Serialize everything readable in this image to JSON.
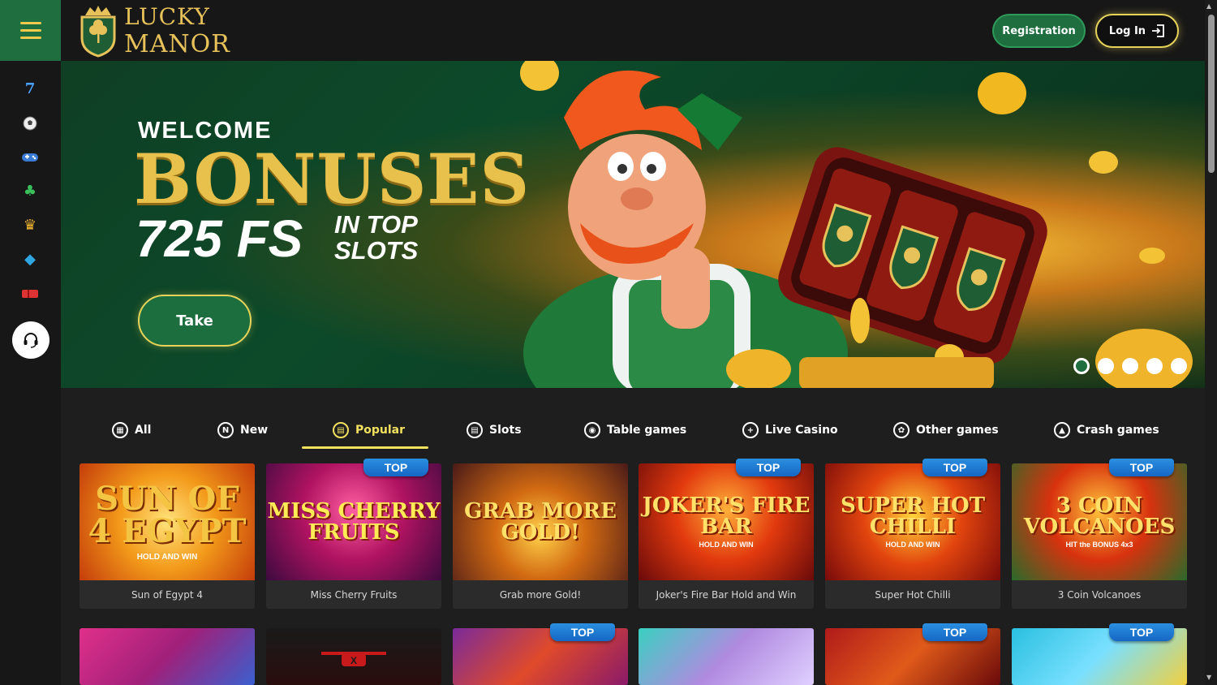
{
  "brand": {
    "logo_line1": "LUCKY",
    "logo_line2": "MANOR",
    "accent": "#1f6e3f",
    "gold": "#e6d35a"
  },
  "header": {
    "registration_label": "Registration",
    "login_label": "Log In"
  },
  "sidebar": {
    "items": [
      {
        "icon": "slot-seven-icon",
        "glyph": "7"
      },
      {
        "icon": "soccer-ball-icon",
        "glyph": "⚽"
      },
      {
        "icon": "gamepad-icon",
        "glyph": "🎮"
      },
      {
        "icon": "clover-icon",
        "glyph": "♣"
      },
      {
        "icon": "crown-icon",
        "glyph": "♛"
      },
      {
        "icon": "gem-icon",
        "glyph": "◆"
      },
      {
        "icon": "ticket-icon",
        "glyph": "▬"
      }
    ],
    "support_icon": "headset-icon"
  },
  "banner": {
    "welcome": "WELCOME",
    "bonuses": "BONUSES",
    "fs": "725 FS",
    "in_top_line1": "IN TOP",
    "in_top_line2": "SLOTS",
    "take_label": "Take",
    "slides": 5,
    "active_slide": 1
  },
  "tabs": [
    {
      "label": "All",
      "icon": "grid-icon",
      "active": false
    },
    {
      "label": "New",
      "icon": "new-badge-icon",
      "active": false
    },
    {
      "label": "Popular",
      "icon": "popular-icon",
      "active": true
    },
    {
      "label": "Slots",
      "icon": "slots-icon",
      "active": false
    },
    {
      "label": "Table games",
      "icon": "chip-icon",
      "active": false
    },
    {
      "label": "Live Casino",
      "icon": "live-icon",
      "active": false
    },
    {
      "label": "Other games",
      "icon": "other-games-icon",
      "active": false
    },
    {
      "label": "Crash games",
      "icon": "crash-icon",
      "active": false
    }
  ],
  "games_row1": [
    {
      "name": "Sun of Egypt 4",
      "art": "SUN OF 4 EGYPT",
      "sub": "HOLD AND WIN",
      "top": false
    },
    {
      "name": "Miss Cherry Fruits",
      "art": "MISS CHERRY FRUITS",
      "sub": "",
      "top": true
    },
    {
      "name": "Grab more Gold!",
      "art": "GRAB MORE GOLD!",
      "sub": "",
      "top": false
    },
    {
      "name": "Joker's Fire Bar Hold and Win",
      "art": "JOKER'S FIRE BAR",
      "sub": "HOLD AND WIN",
      "top": true
    },
    {
      "name": "Super Hot Chilli",
      "art": "SUPER HOT CHILLI",
      "sub": "HOLD AND WIN",
      "top": true
    },
    {
      "name": "3 Coin Volcanoes",
      "art": "3 COIN VOLCANOES",
      "sub": "HIT the BONUS 4x3",
      "top": true
    }
  ],
  "games_row2_top": [
    false,
    false,
    true,
    false,
    true,
    true
  ],
  "top_badge_label": "TOP"
}
